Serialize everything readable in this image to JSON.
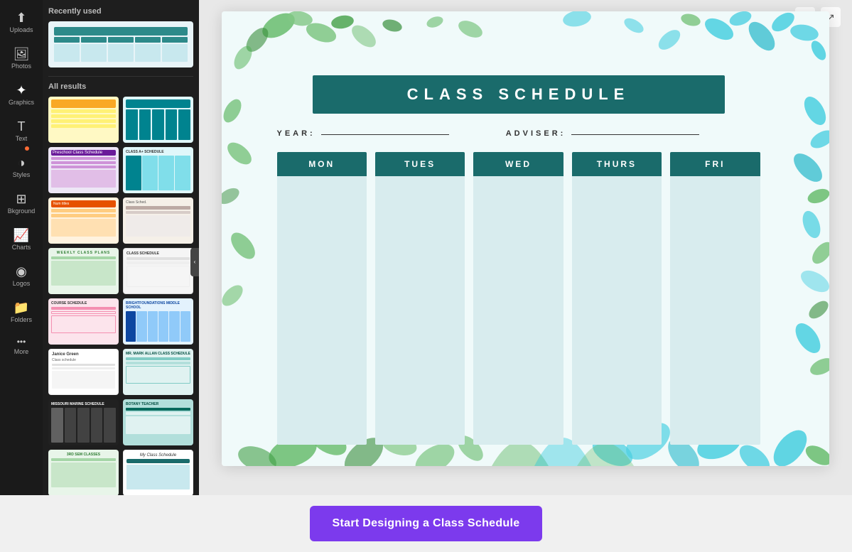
{
  "sidebar": {
    "section_recent": "Recently used",
    "section_all": "All results",
    "icons": [
      {
        "id": "uploads",
        "symbol": "⬆",
        "label": "Uploads"
      },
      {
        "id": "photos",
        "symbol": "🖼",
        "label": "Photos"
      },
      {
        "id": "graphics",
        "symbol": "✦",
        "label": "Graphics"
      },
      {
        "id": "text",
        "symbol": "T",
        "label": "Text"
      },
      {
        "id": "styles",
        "symbol": "◑",
        "label": "Styles"
      },
      {
        "id": "background",
        "symbol": "⊞",
        "label": "Bkground"
      },
      {
        "id": "charts",
        "symbol": "📈",
        "label": "Charts"
      },
      {
        "id": "logos",
        "symbol": "◉",
        "label": "Logos"
      },
      {
        "id": "folders",
        "symbol": "📁",
        "label": "Folders"
      },
      {
        "id": "more",
        "symbol": "•••",
        "label": "More"
      }
    ],
    "templates": [
      {
        "id": "tmpl-1",
        "style": "blue-lines"
      },
      {
        "id": "tmpl-2",
        "style": "yellow"
      },
      {
        "id": "tmpl-3",
        "style": "green-floral"
      },
      {
        "id": "tmpl-4",
        "style": "teal"
      },
      {
        "id": "tmpl-5",
        "style": "purple"
      },
      {
        "id": "tmpl-6",
        "style": "orange"
      },
      {
        "id": "tmpl-7",
        "style": "pink"
      },
      {
        "id": "tmpl-8",
        "style": "white-simple"
      },
      {
        "id": "tmpl-9",
        "style": "beige"
      },
      {
        "id": "tmpl-10",
        "style": "dark-blue"
      },
      {
        "id": "tmpl-11",
        "style": "white-name"
      },
      {
        "id": "tmpl-12",
        "style": "teal2"
      },
      {
        "id": "tmpl-13",
        "style": "black-bars"
      },
      {
        "id": "tmpl-14",
        "style": "light-teal"
      },
      {
        "id": "tmpl-15",
        "style": "white2"
      },
      {
        "id": "tmpl-16",
        "style": "pink"
      }
    ]
  },
  "canvas": {
    "toolbar": {
      "copy_icon": "⧉",
      "export_icon": "↗"
    },
    "schedule": {
      "title": "CLASS SCHEDULE",
      "year_label": "YEAR:",
      "adviser_label": "ADVISER:",
      "days": [
        "MON",
        "TUES",
        "WED",
        "THURS",
        "FRI"
      ]
    }
  },
  "cta": {
    "button_label": "Start Designing a Class Schedule"
  }
}
